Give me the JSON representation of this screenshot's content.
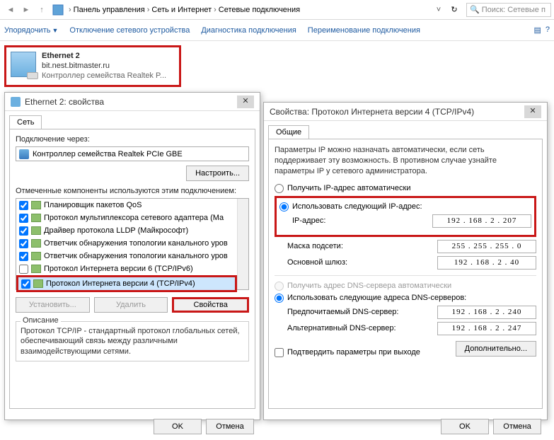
{
  "addressBar": {
    "pathParts": [
      "Панель управления",
      "Сеть и Интернет",
      "Сетевые подключения"
    ],
    "searchPlaceholder": "Поиск: Сетевые п"
  },
  "toolbar": {
    "organize": "Упорядочить",
    "disable": "Отключение сетевого устройства",
    "diagnose": "Диагностика подключения",
    "rename": "Переименование подключения"
  },
  "connection": {
    "name": "Ethernet 2",
    "domain": "bit.nest.bitmaster.ru",
    "device": "Контроллер семейства Realtek P..."
  },
  "dialog1": {
    "title": "Ethernet 2: свойства",
    "tab": "Сеть",
    "connVia": "Подключение через:",
    "adapter": "Контроллер семейства Realtek PCIe GBE",
    "configure": "Настроить...",
    "compsLabel": "Отмеченные компоненты используются этим подключением:",
    "components": [
      {
        "checked": true,
        "label": "Планировщик пакетов QoS"
      },
      {
        "checked": true,
        "label": "Протокол мультиплексора сетевого адаптера (Ма"
      },
      {
        "checked": true,
        "label": "Драйвер протокола LLDP (Майкрософт)"
      },
      {
        "checked": true,
        "label": "Ответчик обнаружения топологии канального уров"
      },
      {
        "checked": true,
        "label": "Ответчик обнаружения топологии канального уров"
      },
      {
        "checked": false,
        "label": "Протокол Интернета версии 6 (TCP/IPv6)"
      },
      {
        "checked": true,
        "label": "Протокол Интернета версии 4 (TCP/IPv4)",
        "selected": true
      }
    ],
    "install": "Установить...",
    "remove": "Удалить",
    "properties": "Свойства",
    "descLegend": "Описание",
    "descText": "Протокол TCP/IP - стандартный протокол глобальных сетей, обеспечивающий связь между различными взаимодействующими сетями.",
    "ok": "OK",
    "cancel": "Отмена"
  },
  "dialog2": {
    "title": "Свойства: Протокол Интернета версии 4 (TCP/IPv4)",
    "tab": "Общие",
    "info": "Параметры IP можно назначать автоматически, если сеть поддерживает эту возможность. В противном случае узнайте параметры IP у сетевого администратора.",
    "autoIp": "Получить IP-адрес автоматически",
    "useIp": "Использовать следующий IP-адрес:",
    "ipLabel": "IP-адрес:",
    "ipValue": "192 . 168 .   2  . 207",
    "maskLabel": "Маска подсети:",
    "maskValue": "255 . 255 . 255 .   0",
    "gwLabel": "Основной шлюз:",
    "gwValue": "192 . 168 .   2  .  40",
    "autoDns": "Получить адрес DNS-сервера автоматически",
    "useDns": "Использовать следующие адреса DNS-серверов:",
    "dns1Label": "Предпочитаемый DNS-сервер:",
    "dns1Value": "192 . 168 .   2  . 240",
    "dns2Label": "Альтернативный DNS-сервер:",
    "dns2Value": "192 . 168 .   2  . 247",
    "validate": "Подтвердить параметры при выходе",
    "advanced": "Дополнительно...",
    "ok": "OK",
    "cancel": "Отмена"
  }
}
